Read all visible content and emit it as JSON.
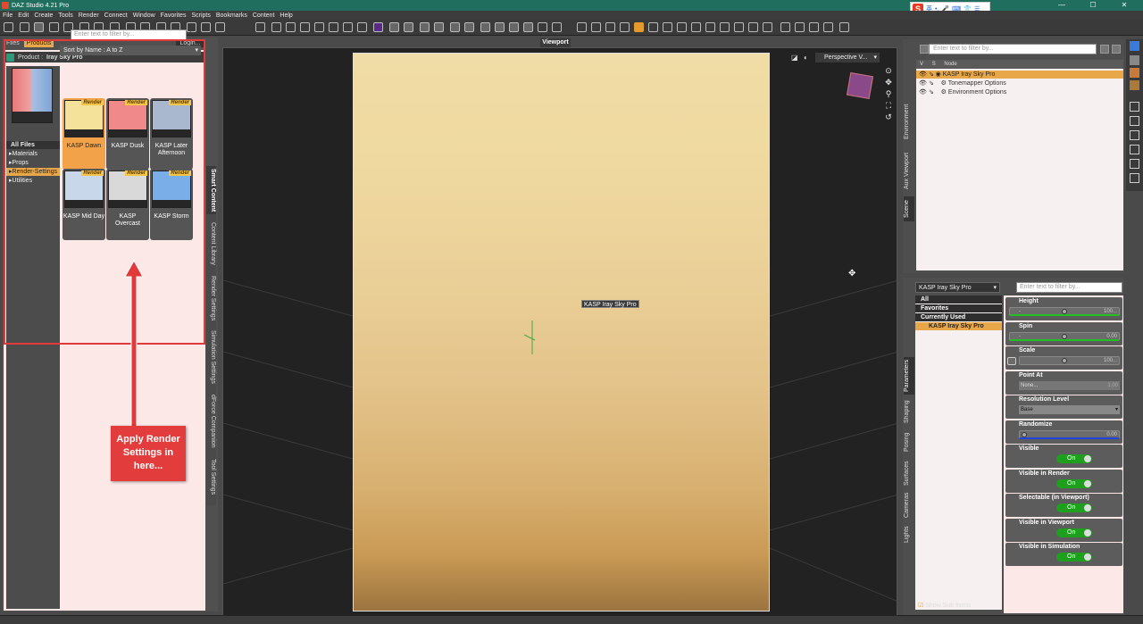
{
  "window": {
    "title": "DAZ Studio 4.21 Pro",
    "minimize": "—",
    "maximize": "☐",
    "close": "✕"
  },
  "ime": {
    "logo": "S",
    "mode": "英"
  },
  "menu": [
    "File",
    "Edit",
    "Create",
    "Tools",
    "Render",
    "Connect",
    "Window",
    "Favorites",
    "Scripts",
    "Bookmarks",
    "Content",
    "Help"
  ],
  "left_panel": {
    "tabs": [
      "Files",
      "Products"
    ],
    "active_tab": "Products",
    "login": "Login...",
    "product_label": "Product :",
    "product_name": "Iray Sky Pro",
    "filter_placeholder": "Enter text to filter by...",
    "count": "1 - 6",
    "sort": "Sort by Name : A to Z",
    "categories": [
      "All Files",
      "Materials",
      "Props",
      "Render-Settings",
      "Utilities"
    ],
    "selected_category": "Render-Settings",
    "items": [
      {
        "label": "KASP Dawn",
        "badge": "Render",
        "color": "#f5e29a"
      },
      {
        "label": "KASP Dusk",
        "badge": "Render",
        "color": "#f08a8a"
      },
      {
        "label": "KASP Later Afternoon",
        "badge": "Render",
        "color": "#a9b8cf"
      },
      {
        "label": "KASP Mid Day",
        "badge": "Render",
        "color": "#c9d7ea"
      },
      {
        "label": "KASP Overcast",
        "badge": "Render",
        "color": "#d9d9d9"
      },
      {
        "label": "KASP Storm",
        "badge": "Render",
        "color": "#7aaee8"
      }
    ],
    "vertical_tabs": [
      "Smart Content",
      "Content Library",
      "Render Settings",
      "Simulation Settings",
      "dForce Companion",
      "Tool Settings"
    ]
  },
  "annotation": {
    "text": "Apply Render Settings in here..."
  },
  "viewport": {
    "tab": "Viewport",
    "camera": "Perspective V...",
    "object_label": "KASP Iray Sky Pro"
  },
  "scene": {
    "filter_placeholder": "Enter text to filter by...",
    "columns": [
      "V",
      "S",
      "Node"
    ],
    "nodes": [
      {
        "label": "KASP Iray Sky Pro",
        "selected": true
      },
      {
        "label": "Tonemapper Options",
        "selected": false
      },
      {
        "label": "Environment Options",
        "selected": false
      }
    ],
    "vertical_tabs": [
      "Environment",
      "Aux Viewport",
      "Scene"
    ]
  },
  "parameters": {
    "node": "KASP Iray Sky Pro",
    "filter_placeholder": "Enter text to filter by...",
    "groups": [
      "All",
      "Favorites",
      "Currently Used",
      "KASP Iray Sky Pro"
    ],
    "selected_group": "KASP Iray Sky Pro",
    "vertical_tabs": [
      "Parameters",
      "Shaping",
      "Posing",
      "Surfaces",
      "Cameras",
      "Lights"
    ],
    "items": {
      "height": {
        "label": "Height",
        "value": "100..."
      },
      "spin": {
        "label": "Spin",
        "value": "0.00"
      },
      "scale": {
        "label": "Scale",
        "value": "100..."
      },
      "point_at": {
        "label": "Point At",
        "value": "None...",
        "extra": "1.00"
      },
      "resolution": {
        "label": "Resolution Level",
        "value": "Base"
      },
      "randomize": {
        "label": "Randomize",
        "value": "0.00"
      },
      "visible": {
        "label": "Visible",
        "value": "On"
      },
      "visible_render": {
        "label": "Visible in Render",
        "value": "On"
      },
      "selectable": {
        "label": "Selectable (in Viewport)",
        "value": "On"
      },
      "visible_viewport": {
        "label": "Visible in Viewport",
        "value": "On"
      },
      "visible_sim": {
        "label": "Visible in Simulation",
        "value": "On"
      }
    },
    "show_sub_items": "Show Sub Items"
  }
}
